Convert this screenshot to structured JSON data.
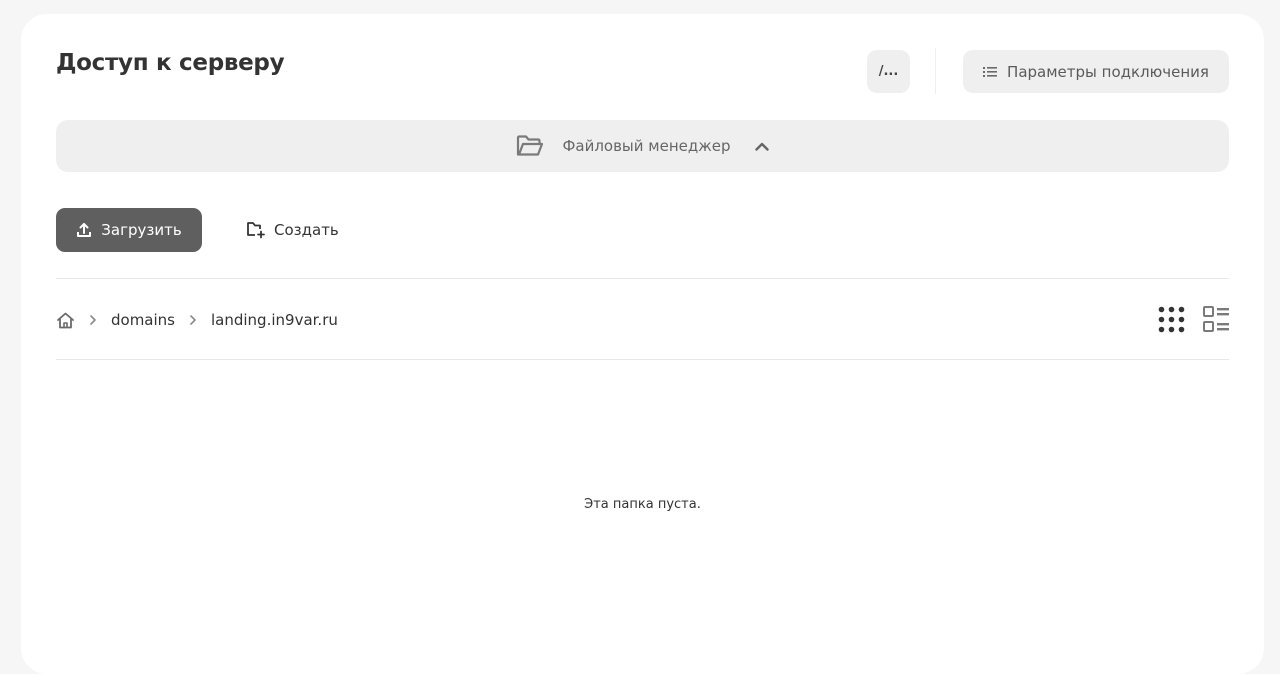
{
  "header": {
    "title": "Доступ к серверу",
    "path_button_label": "/...",
    "connection_button_label": "Параметры подключения"
  },
  "file_manager": {
    "label": "Файловый менеджер",
    "expanded": true
  },
  "toolbar": {
    "upload_label": "Загрузить",
    "create_label": "Создать"
  },
  "breadcrumb": {
    "home_icon": "home-icon",
    "items": [
      "domains",
      "landing.in9var.ru"
    ]
  },
  "view_modes": [
    "grid-view-icon",
    "list-view-icon"
  ],
  "empty_state": {
    "message": "Эта папка пуста."
  },
  "colors": {
    "accent_dark": "#5f5f5f",
    "button_grey": "#efefef",
    "background": "#f6f6f6"
  }
}
